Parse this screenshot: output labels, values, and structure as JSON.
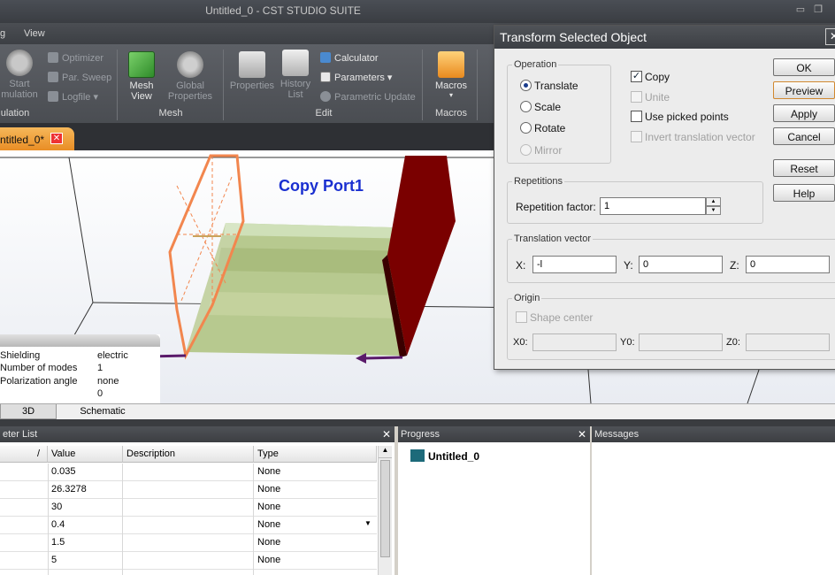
{
  "window": {
    "title": "Untitled_0 - CST STUDIO SUITE"
  },
  "menu": {
    "items": [
      "g",
      "View"
    ]
  },
  "ribbon": {
    "start_simulation": "Start\nmulation",
    "optimizer": "Optimizer",
    "par_sweep": "Par. Sweep",
    "logfile": "Logfile",
    "group_simulation": "ulation",
    "mesh_view": "Mesh\nView",
    "global_properties": "Global\nProperties",
    "group_mesh": "Mesh",
    "properties": "Properties",
    "history_list": "History\nList",
    "calculator": "Calculator",
    "parameters": "Parameters",
    "parametric_update": "Parametric Update",
    "group_edit": "Edit",
    "macros": "Macros",
    "group_macros": "Macros"
  },
  "doc_tab": {
    "label": "ntitled_0*"
  },
  "viewport": {
    "label": "Copy Port1",
    "info": [
      {
        "key": "Shielding",
        "value": "electric"
      },
      {
        "key": "Number of modes",
        "value": "1"
      },
      {
        "key": "Polarization angle",
        "value": "none"
      },
      {
        "key": "",
        "value": "0"
      }
    ]
  },
  "view_tabs": [
    "3D",
    "Schematic"
  ],
  "param_panel": {
    "title": "eter List",
    "columns": [
      "/",
      "Value",
      "Description",
      "Type"
    ],
    "rows": [
      {
        "value": "0.035",
        "description": "",
        "type": "None"
      },
      {
        "value": "26.3278",
        "description": "",
        "type": "None"
      },
      {
        "value": "30",
        "description": "",
        "type": "None"
      },
      {
        "value": "0.4",
        "description": "",
        "type": "None"
      },
      {
        "value": "1.5",
        "description": "",
        "type": "None"
      },
      {
        "value": "5",
        "description": "",
        "type": "None"
      }
    ]
  },
  "progress_panel": {
    "title": "Progress",
    "item": "Untitled_0"
  },
  "messages_panel": {
    "title": "Messages"
  },
  "dialog": {
    "title": "Transform Selected Object",
    "operation_label": "Operation",
    "translate": "Translate",
    "scale": "Scale",
    "rotate": "Rotate",
    "mirror": "Mirror",
    "copy": "Copy",
    "unite": "Unite",
    "use_picked_points": "Use picked points",
    "invert_translation": "Invert translation vector",
    "repetitions_label": "Repetitions",
    "repetition_factor_label": "Repetition factor:",
    "repetition_factor": "1",
    "translation_label": "Translation vector",
    "x_label": "X:",
    "x_value": "-l",
    "y_label": "Y:",
    "y_value": "0",
    "z_label": "Z:",
    "z_value": "0",
    "origin_label": "Origin",
    "shape_center": "Shape center",
    "x0_label": "X0:",
    "y0_label": "Y0:",
    "z0_label": "Z0:",
    "ok": "OK",
    "preview": "Preview",
    "apply": "Apply",
    "cancel": "Cancel",
    "reset": "Reset",
    "help": "Help"
  }
}
